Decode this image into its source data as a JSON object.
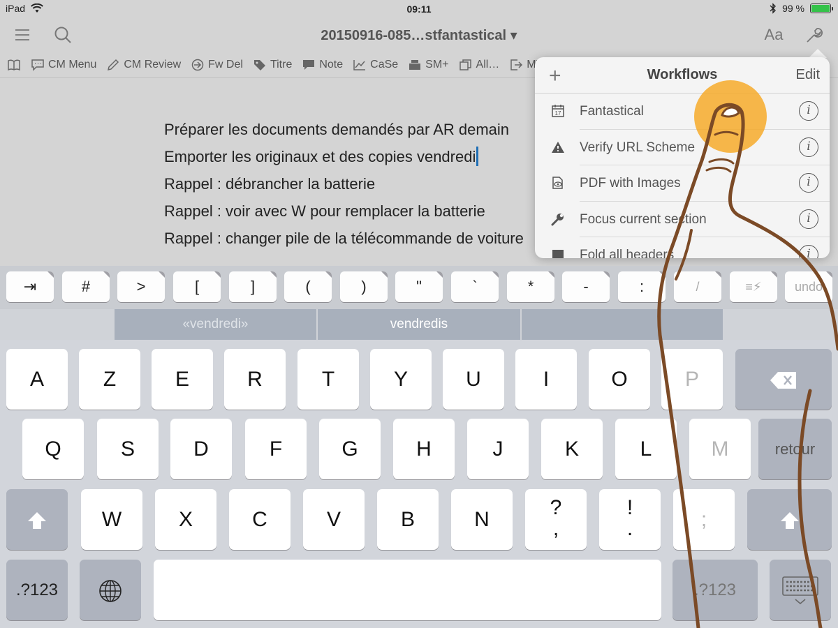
{
  "status": {
    "device": "iPad",
    "time": "09:11",
    "battery": "99 %",
    "battery_fraction": 0.99
  },
  "nav": {
    "title": "20150916-085…stfantastical ▾",
    "font_button": "Aa"
  },
  "toolbar": {
    "items": [
      "CM Menu",
      "CM Review",
      "Fw Del",
      "Titre",
      "Note",
      "CaSe",
      "SM+",
      "All…",
      "MT"
    ]
  },
  "editor": {
    "lines": [
      "Préparer les documents demandés par AR demain",
      "Emporter les originaux et des copies vendredi",
      "Rappel : débrancher la batterie",
      "Rappel : voir avec W pour remplacer la batterie",
      "Rappel : changer pile de la télécommande de voiture"
    ]
  },
  "workflows": {
    "add": "+",
    "title": "Workflows",
    "edit": "Edit",
    "info": "i",
    "items": [
      {
        "label": "Fantastical",
        "icon": "calendar-icon"
      },
      {
        "label": "Verify URL Scheme",
        "icon": "warning-icon"
      },
      {
        "label": "PDF with Images",
        "icon": "document-eye-icon"
      },
      {
        "label": "Focus current section",
        "icon": "wrench-icon"
      },
      {
        "label": "Fold all headers",
        "icon": "fold-icon"
      }
    ]
  },
  "accessory": {
    "keys": [
      "⇥",
      "#",
      ">",
      "[",
      "]",
      "(",
      ")",
      "\"",
      "`",
      "*",
      "-",
      ":",
      "/",
      "≡⚡",
      "undo"
    ]
  },
  "suggestions": [
    "«vendredi»",
    "vendredis",
    ""
  ],
  "keyboard": {
    "row1": [
      "A",
      "Z",
      "E",
      "R",
      "T",
      "Y",
      "U",
      "I",
      "O",
      "P"
    ],
    "row2": [
      "Q",
      "S",
      "D",
      "F",
      "G",
      "H",
      "J",
      "K",
      "L",
      "M"
    ],
    "row3": [
      "W",
      "X",
      "C",
      "V",
      "B",
      "N"
    ],
    "row3_punct": [
      [
        "?",
        ","
      ],
      [
        "!",
        "."
      ],
      [
        ";"
      ]
    ],
    "return": "retour",
    "numbers": ".?123"
  },
  "colors": {
    "cursor": "#1f6fb5",
    "battery": "#35c34a",
    "touch": "#f7a823",
    "gesture_line": "#7b4a26"
  }
}
